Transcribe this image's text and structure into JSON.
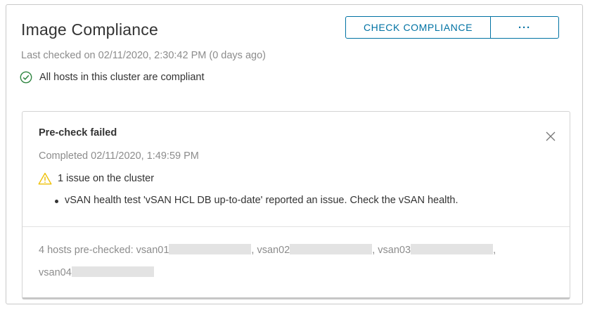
{
  "panel": {
    "title": "Image Compliance",
    "check_button": "CHECK COMPLIANCE",
    "more_button": "···",
    "last_checked": "Last checked on 02/11/2020, 2:30:42 PM (0 days ago)",
    "status_text": "All hosts in this cluster are compliant",
    "status_color": "#2e8540"
  },
  "precheck": {
    "title": "Pre-check failed",
    "completed": "Completed 02/11/2020, 1:49:59 PM",
    "issue_summary": "1 issue on the cluster",
    "warning_color": "#efc006",
    "issues": [
      "vSAN health test 'vSAN HCL DB up-to-date' reported an issue. Check the vSAN health."
    ],
    "hosts_prefix": "4 hosts pre-checked: ",
    "hosts": [
      "vsan01",
      "vsan02",
      "vsan03",
      "vsan04"
    ],
    "separator": ", "
  }
}
